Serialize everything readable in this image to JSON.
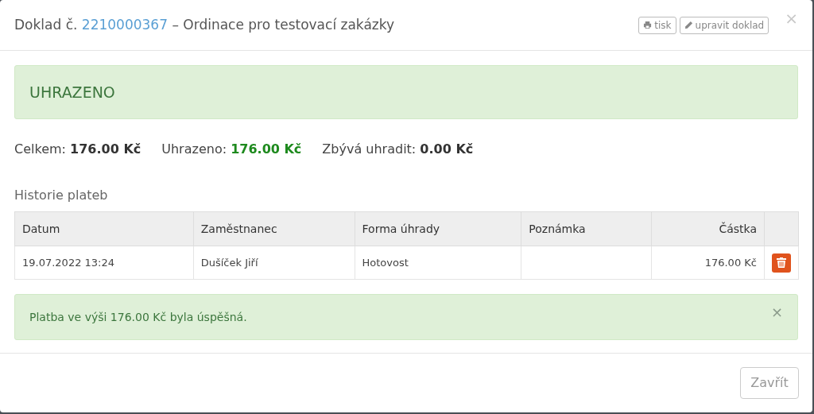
{
  "window": {
    "title_prefix": "Doklad č.",
    "doc_number": "2210000367",
    "title_suffix": "– Ordinace pro testovací zakázky"
  },
  "header_buttons": [
    "tisk",
    "upravit doklad"
  ],
  "close": "×",
  "status": {
    "label": "UHRAZENO",
    "kind": "success"
  },
  "summary": [
    {
      "label": "Celkem:",
      "value": "176.00 Kč",
      "kind": "plain"
    },
    {
      "label": "Uhrazeno:",
      "value": "176.00 Kč",
      "kind": "paid"
    },
    {
      "label": "Zbývá uhradit:",
      "value": "0.00 Kč",
      "kind": "plain"
    }
  ],
  "history": {
    "title": "Historie plateb",
    "columns": [
      "Datum",
      "Zaměstnanec",
      "Forma úhrady",
      "Poznámka",
      "Částka"
    ],
    "rows": [
      {
        "cells": [
          "19.07.2022 13:24",
          "Dušíček Jiří",
          "Hotovost",
          "",
          "176.00 Kč"
        ]
      }
    ]
  },
  "message": {
    "text": "Platba ve výši 176.00 Kč byla úspěšná.",
    "close": "×"
  },
  "footer_buttons": [
    "Zavřít"
  ]
}
